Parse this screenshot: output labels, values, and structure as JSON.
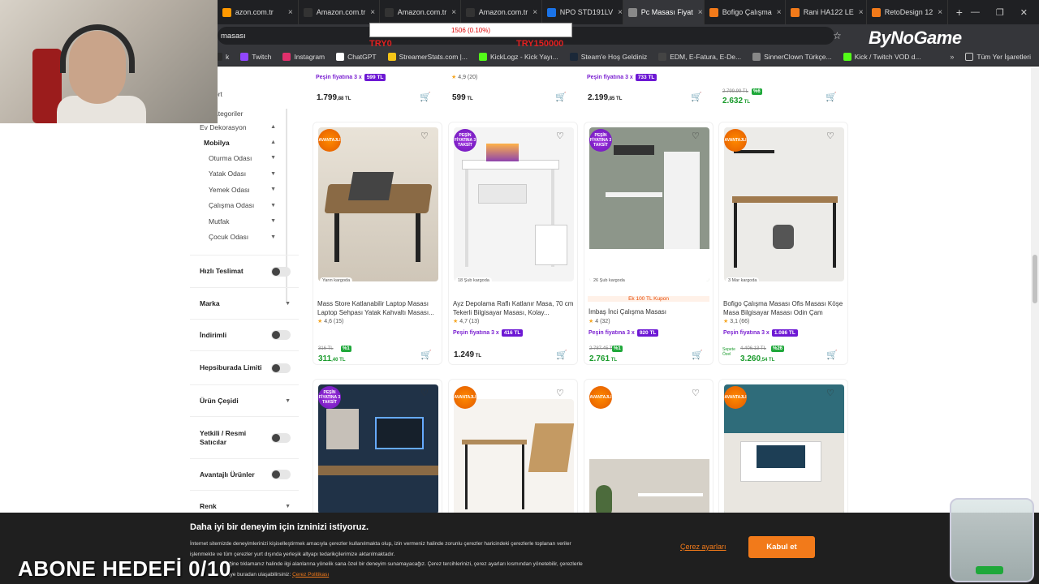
{
  "browser": {
    "tabs": [
      {
        "label": "azon.com.tr",
        "color": "#ff9900"
      },
      {
        "label": "Amazon.com.tr",
        "color": "#333333"
      },
      {
        "label": "Amazon.com.tr",
        "color": "#333333"
      },
      {
        "label": "Amazon.com.tr",
        "color": "#333333"
      },
      {
        "label": "NPO STD191LV",
        "color": "#1a73e8"
      },
      {
        "label": "Pc Masası Fiyat",
        "color": "#888888"
      },
      {
        "label": "Bofigo Çalışma",
        "color": "#f27a1a"
      },
      {
        "label": "Rani HA122 LE",
        "color": "#f27a1a"
      },
      {
        "label": "RetoDesign 12",
        "color": "#f27a1a"
      }
    ],
    "address": "masası",
    "bookmarks": [
      {
        "label": "k",
        "color": "#2b2b2b"
      },
      {
        "label": "Twitch",
        "color": "#9146ff"
      },
      {
        "label": "Instagram",
        "color": "#e1306c"
      },
      {
        "label": "ChatGPT",
        "color": "#ffffff"
      },
      {
        "label": "StreamerStats.com |...",
        "color": "#f5c518"
      },
      {
        "label": "KickLogz - Kick Yayı...",
        "color": "#53fc18"
      },
      {
        "label": "Steam'e Hoş Geldiniz",
        "color": "#1b2838"
      },
      {
        "label": "EDM, E-Fatura, E-De...",
        "color": "#444444"
      },
      {
        "label": "SinnerClown Türkçe...",
        "color": "#888888"
      },
      {
        "label": "Kick / Twitch VOD d...",
        "color": "#53fc18"
      }
    ],
    "all_bookmarks": "Tüm Yer İşaretleri"
  },
  "stream_overlay": {
    "bar_text": "1506 (0.10%)",
    "left_tag": "TRY0",
    "right_tag": "TRY150000",
    "brand": "ByNoGame",
    "subscriber_goal": "ABONE HEDEFİ 0/10"
  },
  "sidebar": {
    "top_label": "ort",
    "categories_label": "ategoriler",
    "ev_dekorasyon": "Ev Dekorasyon",
    "mobilya": "Mobilya",
    "subcategories": [
      "Oturma Odası",
      "Yatak Odası",
      "Yemek Odası",
      "Çalışma Odası",
      "Mutfak",
      "Çocuk Odası"
    ],
    "filters": [
      {
        "label": "Hızlı Teslimat",
        "kind": "toggle"
      },
      {
        "label": "Marka",
        "kind": "dropdown"
      },
      {
        "label": "İndirimli",
        "kind": "toggle"
      },
      {
        "label": "Hepsiburada Limiti",
        "kind": "toggle"
      },
      {
        "label": "Ürün Çeşidi",
        "kind": "dropdown"
      },
      {
        "label": "Yetkili / Resmi Satıcılar",
        "kind": "toggle"
      },
      {
        "label": "Avantajlı Ürünler",
        "kind": "toggle"
      },
      {
        "label": "Renk",
        "kind": "dropdown"
      }
    ]
  },
  "top_row": [
    {
      "pesin": "Peşin fiyatına 3 x",
      "pill": "599 TL",
      "price_main": "1.799",
      "price_dec": ",88 TL"
    },
    {
      "rating": "4,9 (20)",
      "price_main": "599",
      "price_dec": " TL"
    },
    {
      "pesin": "Peşin fiyatına 3 x",
      "pill": "733 TL",
      "price_main": "2.199",
      "price_dec": ",85 TL"
    },
    {
      "old": "2.799,99 TL",
      "disc": "%6",
      "price_main": "2.632",
      "price_dec": " TL"
    }
  ],
  "products": [
    {
      "badge": "AVANTAJLI",
      "ship": "Yarın kargoda",
      "name": "Mass Store Katlanabilir Laptop Masası Laptop Sehpası Yatak Kahvaltı Masası...",
      "rating": "4,6 (15)",
      "old": "316 TL",
      "disc": "%1",
      "price_main": "311",
      "price_dec": ",40 TL"
    },
    {
      "badge": "PEŞİN FİYATINA 3 TAKSİT",
      "ship": "18 Şub kargoda",
      "name": "Ayz Depolama Raflı Katlanır Masa, 70 cm Tekerli Bilgisayar Masası, Kolay...",
      "rating": "4,7 (13)",
      "pesin": "Peşin fiyatına 3 x",
      "pill": "416 TL",
      "price_main": "1.249",
      "price_dec": " TL"
    },
    {
      "badge": "PEŞİN FİYATINA 3 TAKSİT",
      "ship": "26 Şub kargoda",
      "kupon": "Ek 100 TL Kupon",
      "name": "İmbaş İnci Çalışma Masası",
      "rating": "4 (32)",
      "pesin": "Peşin fiyatına 3 x",
      "pill": "920 TL",
      "old": "2.787,45 TL",
      "disc": "%1",
      "price_main": "2.761",
      "price_dec": " TL"
    },
    {
      "badge": "AVANTAJLI",
      "ship": "3 Mar kargoda",
      "name": "Bofigo Çalışma Masası Ofis Masası Köşe Masa Bilgisayar Masası Odin Çam",
      "rating": "3,1 (66)",
      "pesin": "Peşin fiyatına 3 x",
      "pill": "1.086 TL",
      "old": "4.406,13 TL",
      "disc": "%26",
      "sepette": "Sepete Özel",
      "price_main": "3.260",
      "price_dec": ",54 TL"
    }
  ],
  "bottom_row_badges": [
    "PEŞİN FİYATINA 3 TAKSİT",
    "AVANTAJLI",
    "AVANTAJLI",
    "AVANTAJLI"
  ],
  "cookie": {
    "title": "Daha iyi bir deneyim için izninizi istiyoruz.",
    "line1": "İnternet sitemizde deneyimlerinizi kişiselleştirmek amacıyla çerezler kullanılmakta olup, izin vermeniz halinde zorunlu çerezler haricindeki çerezlerle toplanan veriler",
    "line2": "işlenmekte ve tüm çerezler yurt dışında yerleşik altyapı tedarikçilerimize aktarılmaktadır.",
    "line3": "ğine tıklamanız halinde ilgi alanlarına yönelik sana özel bir deneyim sunamayacağız. Çerez tercihlerinizi, çerez ayarları kısmından yönetebilir, çerezlerle",
    "line4": "iye buradan ulaşabilirsiniz:",
    "policy_link": "Çerez Politikası",
    "settings": "Çerez ayarları",
    "accept": "Kabul et"
  },
  "colors": {
    "accent": "#f27a1a",
    "purple": "#6d18d4",
    "green": "#1fa83a"
  }
}
